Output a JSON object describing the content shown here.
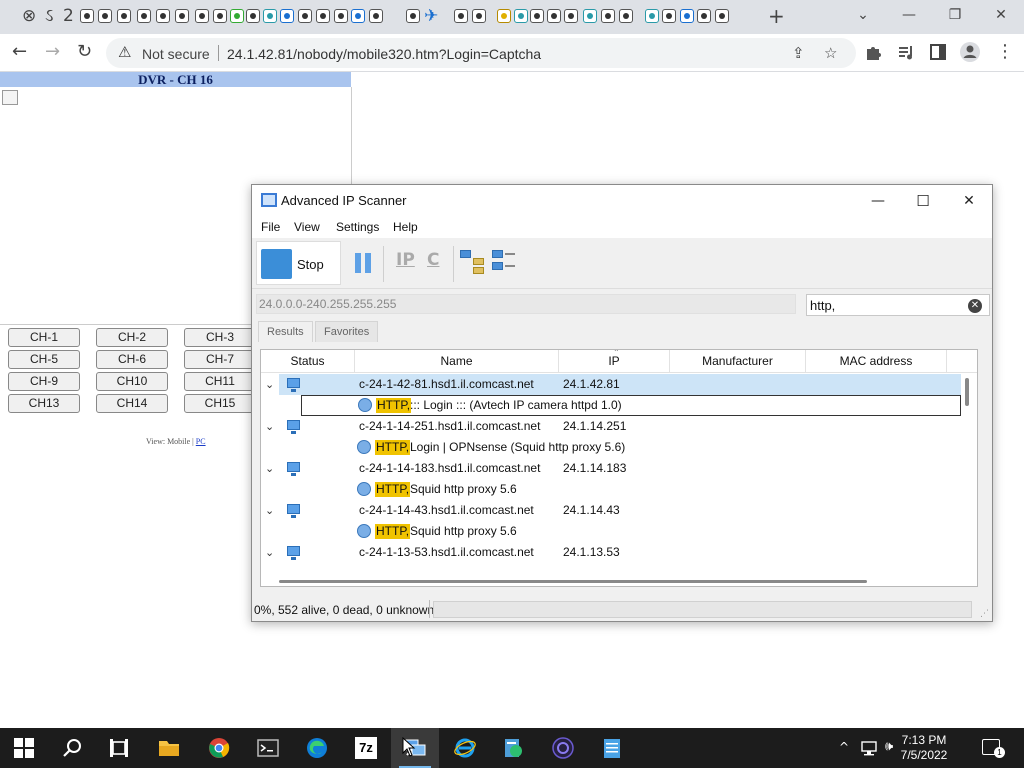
{
  "browser": {
    "tab_glyphs": [
      "ઽ",
      "2"
    ],
    "new_tab": "+",
    "tab_list": "⌄",
    "minimize": "—",
    "restore": "❐",
    "close": "✕",
    "back": "←",
    "forward": "→",
    "reload": "↻",
    "security_icon": "⚠",
    "security_label": "Not secure",
    "url": "24.1.42.81/nobody/mobile320.htm?Login=Captcha",
    "share_icon": "⇪",
    "bookmark_icon": "☆",
    "extensions_icon": "puzzle-icon",
    "menu_icon": "⋮"
  },
  "dvr": {
    "title": "DVR - CH 16",
    "channels": [
      "CH-1",
      "CH-2",
      "CH-3",
      "CH-5",
      "CH-6",
      "CH-7",
      "CH-9",
      "CH10",
      "CH11",
      "CH13",
      "CH14",
      "CH15"
    ],
    "view_label": "View: Mobile | ",
    "view_pc": "PC"
  },
  "scanner": {
    "title": "Advanced IP Scanner",
    "menu": [
      "File",
      "View",
      "Settings",
      "Help"
    ],
    "stop_label": "Stop",
    "ip_tool": "IP",
    "c_tool": "C",
    "range": "24.0.0.0-240.255.255.255",
    "search": "http,",
    "clear_icon": "✕",
    "tabs": [
      "Results",
      "Favorites"
    ],
    "columns": [
      "Status",
      "Name",
      "IP",
      "Manufacturer",
      "MAC address"
    ],
    "expand_icon": "⌄",
    "rows": [
      {
        "type": "host",
        "name": "c-24-1-42-81.hsd1.il.comcast.net",
        "ip": "24.1.42.81"
      },
      {
        "type": "service",
        "tag": "HTTP,",
        "text": "::: Login ::: (Avtech IP camera httpd 1.0)"
      },
      {
        "type": "host",
        "name": "c-24-1-14-251.hsd1.il.comcast.net",
        "ip": "24.1.14.251"
      },
      {
        "type": "service",
        "tag": "HTTP,",
        "text": "Login | OPNsense (Squid http proxy 5.6)"
      },
      {
        "type": "host",
        "name": "c-24-1-14-183.hsd1.il.comcast.net",
        "ip": "24.1.14.183"
      },
      {
        "type": "service",
        "tag": "HTTP,",
        "text": "Squid http proxy 5.6"
      },
      {
        "type": "host",
        "name": "c-24-1-14-43.hsd1.il.comcast.net",
        "ip": "24.1.14.43"
      },
      {
        "type": "service",
        "tag": "HTTP,",
        "text": "Squid http proxy 5.6"
      },
      {
        "type": "host",
        "name": "c-24-1-13-53.hsd1.il.comcast.net",
        "ip": "24.1.13.53"
      }
    ],
    "status": "0%, 552 alive, 0 dead, 0 unknown",
    "progress": 0
  },
  "taskbar": {
    "time": "7:13 PM",
    "date": "7/5/2022",
    "tray_chevron": "^",
    "volume_icon": "🕪",
    "notification_count": "1",
    "icons": [
      "start-icon",
      "search-icon",
      "task-view-icon",
      "file-explorer-icon",
      "chrome-icon",
      "terminal-icon",
      "edge-icon",
      "7zip-icon",
      "advanced-ip-scanner-icon",
      "internet-explorer-icon",
      "network-app-icon",
      "obs-icon",
      "notepad-icon"
    ],
    "seven_zip_label": "7z"
  }
}
